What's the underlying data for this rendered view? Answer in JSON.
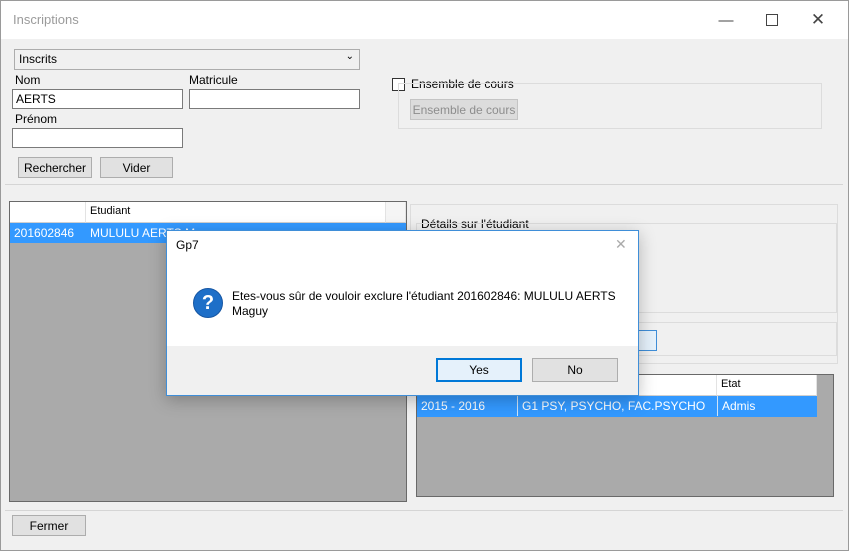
{
  "window": {
    "title": "Inscriptions"
  },
  "search": {
    "combo_value": "Inscrits",
    "nom_label": "Nom",
    "nom_value": "AERTS",
    "matricule_label": "Matricule",
    "matricule_value": "",
    "prenom_label": "Prénom",
    "prenom_value": "",
    "rechercher_label": "Rechercher",
    "vider_label": "Vider"
  },
  "cours": {
    "checkbox_label": "Ensemble de cours",
    "button_label": "Ensemble de cours"
  },
  "students_table": {
    "headers": [
      "",
      "Etudiant"
    ],
    "rows": [
      {
        "matricule": "201602846",
        "etudiant": "MULULU AERTS M..."
      }
    ]
  },
  "details": {
    "group_label": "Détails sur l'étudiant"
  },
  "inscriptions_table": {
    "headers": [
      "",
      "",
      "Etat"
    ],
    "rows": [
      {
        "annee": "2015 - 2016",
        "programme": "G1 PSY, PSYCHO, FAC.PSYCHO",
        "etat": "Admis"
      }
    ]
  },
  "footer": {
    "fermer_label": "Fermer"
  },
  "dialog": {
    "title": "Gp7",
    "icon": "question-icon",
    "message_line1": "Etes-vous sûr de vouloir exclure l'étudiant 201602846: MULULU AERTS",
    "message_line2": "Maguy",
    "yes_label": "Yes",
    "no_label": "No"
  },
  "colors": {
    "selection": "#3399ff",
    "dialog_border": "#3f8ed8",
    "grid_background": "#aaaaaa"
  }
}
